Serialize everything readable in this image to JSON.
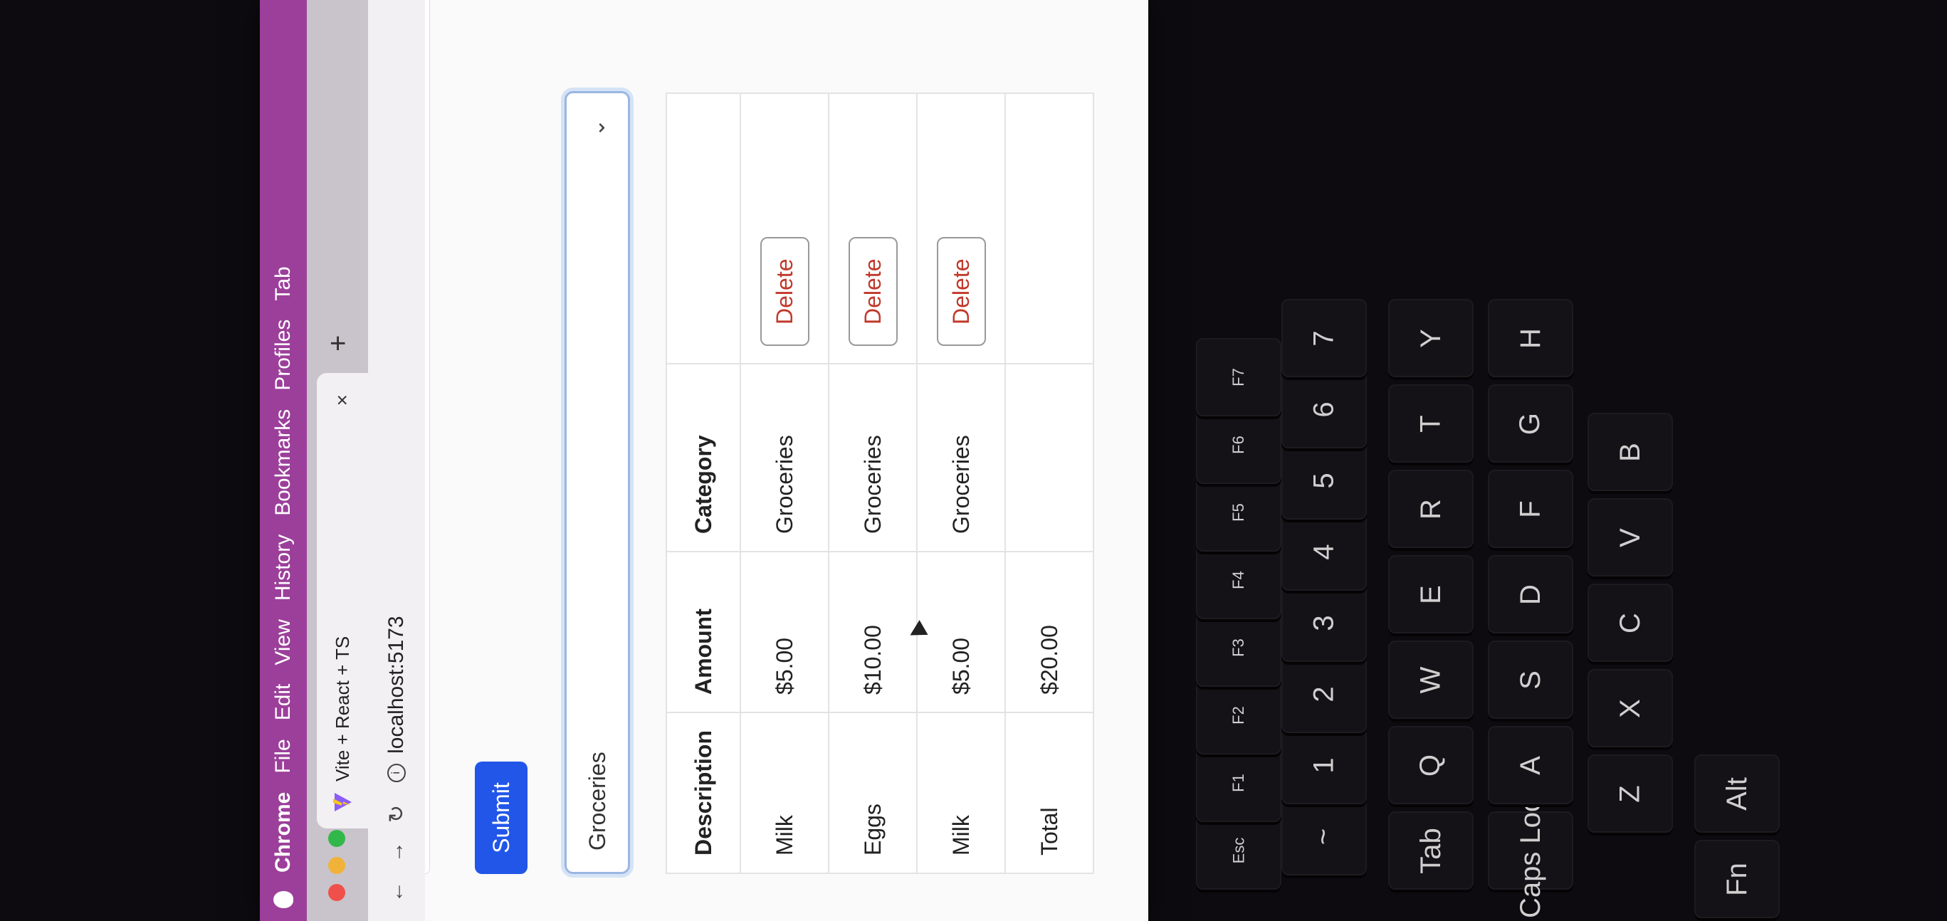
{
  "menubar": {
    "app": "Chrome",
    "items": [
      "File",
      "Edit",
      "View",
      "History",
      "Bookmarks",
      "Profiles",
      "Tab"
    ]
  },
  "tab": {
    "title": "Vite + React + TS",
    "close": "×",
    "new_tab": "+"
  },
  "navbar": {
    "url": "localhost:5173"
  },
  "form": {
    "submit_label": "Submit",
    "category_selected": "Groceries"
  },
  "table": {
    "headers": [
      "Description",
      "Amount",
      "Category",
      ""
    ],
    "rows": [
      {
        "description": "Milk",
        "amount": "$5.00",
        "category": "Groceries",
        "action": "Delete"
      },
      {
        "description": "Eggs",
        "amount": "$10.00",
        "category": "Groceries",
        "action": "Delete"
      },
      {
        "description": "Milk",
        "amount": "$5.00",
        "category": "Groceries",
        "action": "Delete"
      }
    ],
    "total_label": "Total",
    "total_value": "$20.00"
  },
  "keyboard": {
    "keys": [
      "Esc",
      "F1",
      "F2",
      "F3",
      "F4",
      "F5",
      "F6",
      "F7",
      "~",
      "1",
      "2",
      "3",
      "4",
      "5",
      "6",
      "7",
      "Tab",
      "Q",
      "W",
      "E",
      "R",
      "T",
      "Y",
      "Caps Lock",
      "A",
      "S",
      "D",
      "F",
      "G",
      "H",
      "Z",
      "X",
      "C",
      "V",
      "B",
      "Fn",
      "Alt"
    ]
  },
  "colors": {
    "menubar": "#9b3f9a",
    "submit": "#2156e8",
    "delete_text": "#c0392b"
  }
}
